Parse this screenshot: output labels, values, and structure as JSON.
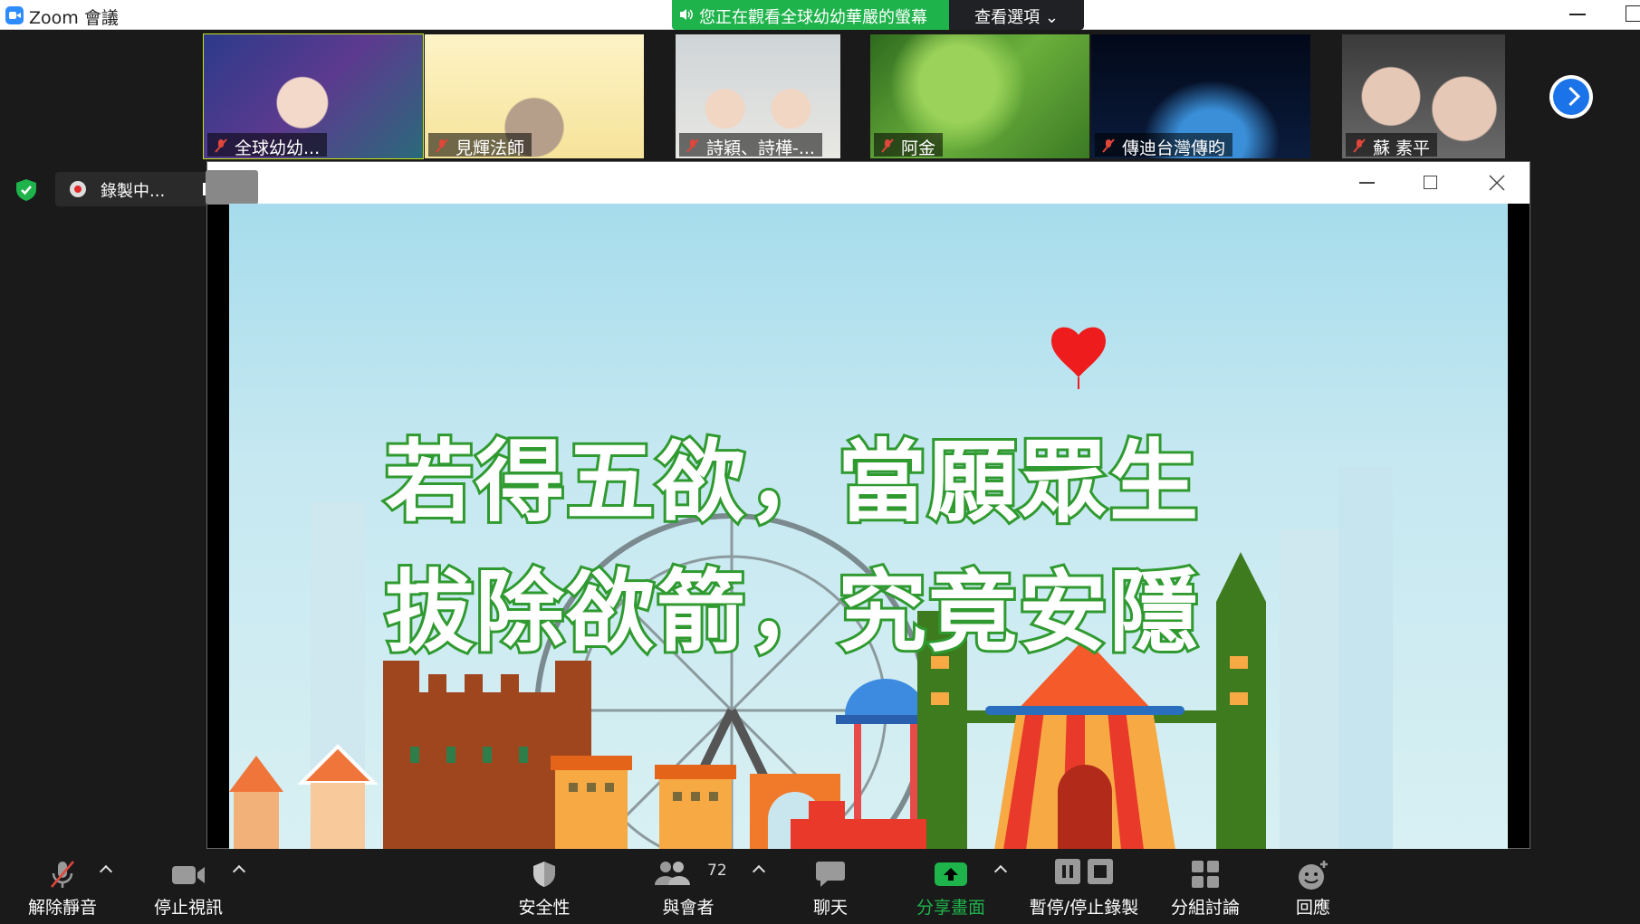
{
  "window": {
    "title": "Zoom 會議"
  },
  "banner": {
    "viewing_text": "您正在觀看全球幼幼華嚴的螢幕",
    "view_options": "查看選項 ⌄"
  },
  "participants": [
    {
      "name": "全球幼幼...",
      "active": true,
      "bg": "#3a4aa0"
    },
    {
      "name": "見輝法師",
      "active": false,
      "bg": "#f3e4a8"
    },
    {
      "name": "詩穎、詩樺-...",
      "active": false,
      "bg": "#d8d6cf"
    },
    {
      "name": "阿金",
      "active": false,
      "bg": "#4b8a2a"
    },
    {
      "name": "傳迪台灣傳昀",
      "active": false,
      "bg": "#0b1c3d"
    },
    {
      "name": "蘇 素平",
      "active": false,
      "bg": "#6a6a6a"
    }
  ],
  "recording": {
    "label": "錄製中..."
  },
  "slide": {
    "line1": "若得五欲，當願眾生",
    "line2": "拔除欲箭，究竟安隱"
  },
  "toolbar": {
    "unmute": "解除靜音",
    "stop_video": "停止視訊",
    "security": "安全性",
    "participants": "與會者",
    "participants_count": "72",
    "chat": "聊天",
    "share_screen": "分享畫面",
    "pause_stop_recording": "暫停/停止錄製",
    "breakout_rooms": "分組討論",
    "reactions": "回應"
  },
  "colors": {
    "accent_green": "#1eb34b",
    "zoom_blue": "#2d8cff",
    "active_outline": "#c6e31a"
  }
}
